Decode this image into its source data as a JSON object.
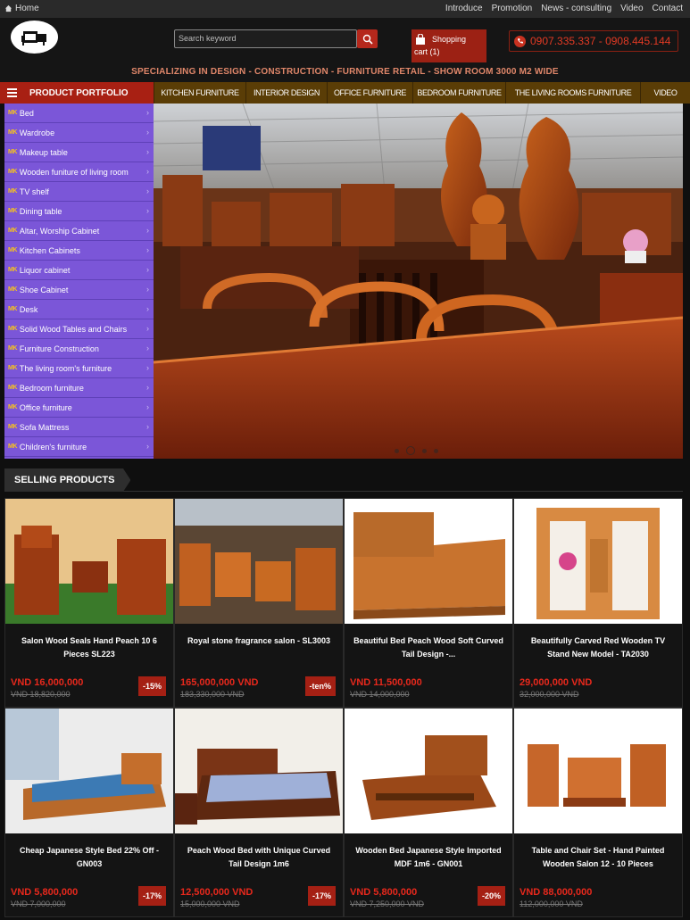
{
  "topbar": {
    "home": "Home",
    "links": [
      "Introduce",
      "Promotion",
      "News - consulting",
      "Video",
      "Contact"
    ]
  },
  "header": {
    "search_placeholder": "Search keyword",
    "cart_line1": "Shopping",
    "cart_line2": "cart (1)",
    "phone": "0907.335.337 - 0908.445.144",
    "slogan": "SPECIALIZING IN DESIGN - CONSTRUCTION - FURNITURE RETAIL - SHOW ROOM 3000 M2 WIDE"
  },
  "nav": {
    "portfolio": "PRODUCT PORTFOLIO",
    "items": [
      "KITCHEN FURNITURE",
      "INTERIOR DESIGN",
      "OFFICE FURNITURE",
      "BEDROOM FURNITURE",
      "THE LIVING ROOMS FURNITURE",
      "VIDEO"
    ]
  },
  "sidebar": {
    "categories": [
      "Bed",
      "Wardrobe",
      "Makeup table",
      "Wooden funiture of living room",
      "TV shelf",
      "Dining table",
      "Altar, Worship Cabinet",
      "Kitchen Cabinets",
      "Liquor cabinet",
      "Shoe Cabinet",
      "Desk",
      "Solid Wood Tables and Chairs",
      "Furniture Construction",
      "The living room's furniture",
      "Bedroom furniture",
      "Office furniture",
      "Sofa Mattress",
      "Children's furniture"
    ]
  },
  "selling": {
    "heading": "SELLING PRODUCTS",
    "products": [
      {
        "name": "Salon Wood Seals Hand Peach 10 6 Pieces SL223",
        "price": "VND 16,000,000",
        "old": "VND 18,820,000",
        "discount": "-15%"
      },
      {
        "name": "Royal stone fragrance salon - SL3003",
        "price": "165,000,000 VND",
        "old": "183,330,000 VND",
        "discount": "-ten%"
      },
      {
        "name": "Beautiful Bed Peach Wood Soft Curved Tail Design -...",
        "price": "VND 11,500,000",
        "old": "VND 14,000,000",
        "discount": ""
      },
      {
        "name": "Beautifully Carved Red Wooden TV Stand New Model - TA2030",
        "price": "29,000,000 VND",
        "old": "32,000,000 VND",
        "discount": ""
      },
      {
        "name": "Cheap Japanese Style Bed 22% Off - GN003",
        "price": "VND 5,800,000",
        "old": "VND 7,000,000",
        "discount": "-17%"
      },
      {
        "name": "Peach Wood Bed with Unique Curved Tail Design 1m6",
        "price": "12,500,000 VND",
        "old": "15,000,000 VND",
        "discount": "-17%"
      },
      {
        "name": "Wooden Bed Japanese Style Imported MDF 1m6 - GN001",
        "price": "VND 5,800,000",
        "old": "VND 7,250,000 VND",
        "discount": "-20%"
      },
      {
        "name": "Table and Chair Set - Hand Painted Wooden Salon 12 - 10 Pieces",
        "price": "VND 88,000,000",
        "old": "112,000,000 VND",
        "discount": ""
      }
    ]
  }
}
